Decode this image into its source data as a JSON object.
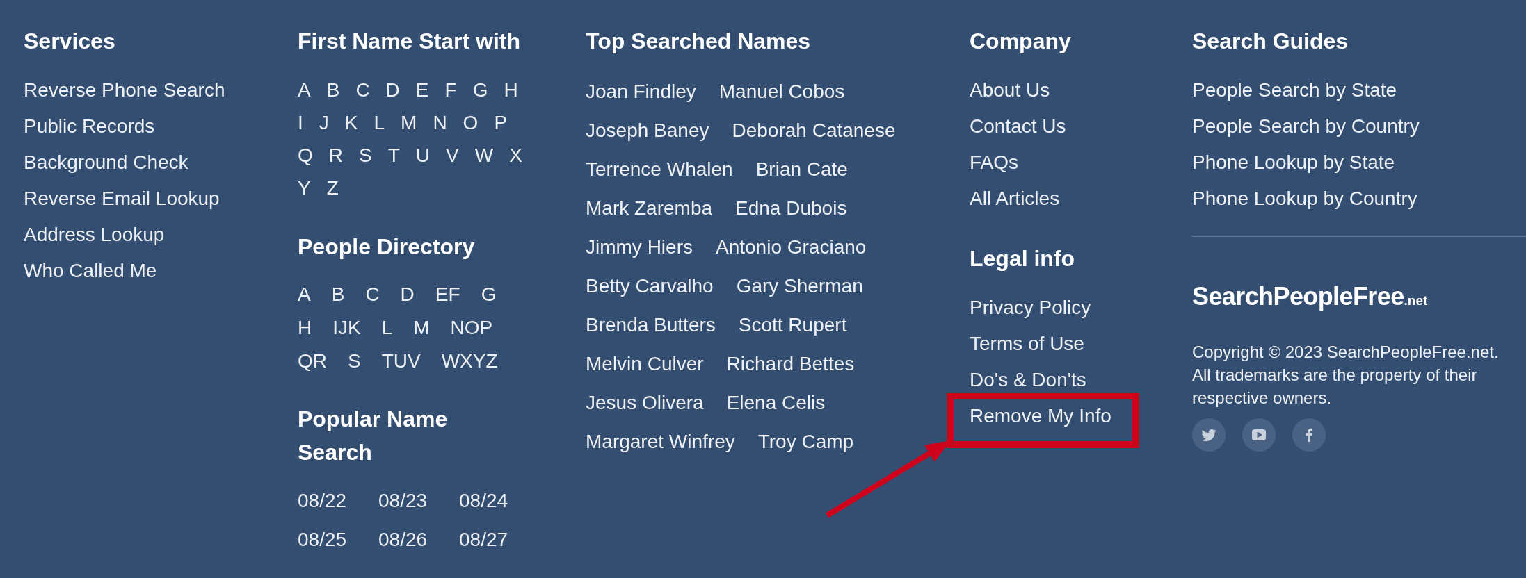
{
  "services": {
    "heading": "Services",
    "links": [
      "Reverse Phone Search",
      "Public Records",
      "Background Check",
      "Reverse Email Lookup",
      "Address Lookup",
      "Who Called Me"
    ]
  },
  "first_name_start": {
    "heading": "First Name Start with",
    "letters": [
      "A",
      "B",
      "C",
      "D",
      "E",
      "F",
      "G",
      "H",
      "I",
      "J",
      "K",
      "L",
      "M",
      "N",
      "O",
      "P",
      "Q",
      "R",
      "S",
      "T",
      "U",
      "V",
      "W",
      "X",
      "Y",
      "Z"
    ]
  },
  "people_directory": {
    "heading": "People Directory",
    "groups": [
      "A",
      "B",
      "C",
      "D",
      "EF",
      "G",
      "H",
      "IJK",
      "L",
      "M",
      "NOP",
      "QR",
      "S",
      "TUV",
      "WXYZ"
    ]
  },
  "popular_name_search": {
    "heading": "Popular Name Search",
    "dates": [
      "08/22",
      "08/23",
      "08/24",
      "08/25",
      "08/26",
      "08/27"
    ]
  },
  "top_searched_names": {
    "heading": "Top Searched Names",
    "names": [
      "Joan Findley",
      "Manuel Cobos",
      "Joseph Baney",
      "Deborah Catanese",
      "Terrence Whalen",
      "Brian Cate",
      "Mark Zaremba",
      "Edna Dubois",
      "Jimmy Hiers",
      "Antonio Graciano",
      "Betty Carvalho",
      "Gary Sherman",
      "Brenda Butters",
      "Scott Rupert",
      "Melvin Culver",
      "Richard Bettes",
      "Jesus Olivera",
      "Elena Celis",
      "Margaret Winfrey",
      "Troy Camp"
    ]
  },
  "company": {
    "heading": "Company",
    "links": [
      "About Us",
      "Contact Us",
      "FAQs",
      "All Articles"
    ]
  },
  "legal_info": {
    "heading": "Legal info",
    "links": [
      {
        "label": "Privacy Policy",
        "highlighted": false
      },
      {
        "label": "Terms of Use",
        "highlighted": false
      },
      {
        "label": "Do's & Don'ts",
        "highlighted": false
      },
      {
        "label": "Remove My Info",
        "highlighted": true
      }
    ]
  },
  "search_guides": {
    "heading": "Search Guides",
    "links": [
      "People Search by State",
      "People Search by Country",
      "Phone Lookup by State",
      "Phone Lookup by Country"
    ]
  },
  "logo": {
    "name": "SearchPeopleFree",
    "suffix": ".net"
  },
  "copyright": "Copyright © 2023 SearchPeopleFree.net. All trademarks are the property of their respective owners.",
  "social_links": [
    {
      "kind": "bird"
    },
    {
      "kind": "play"
    },
    {
      "kind": "f"
    }
  ]
}
